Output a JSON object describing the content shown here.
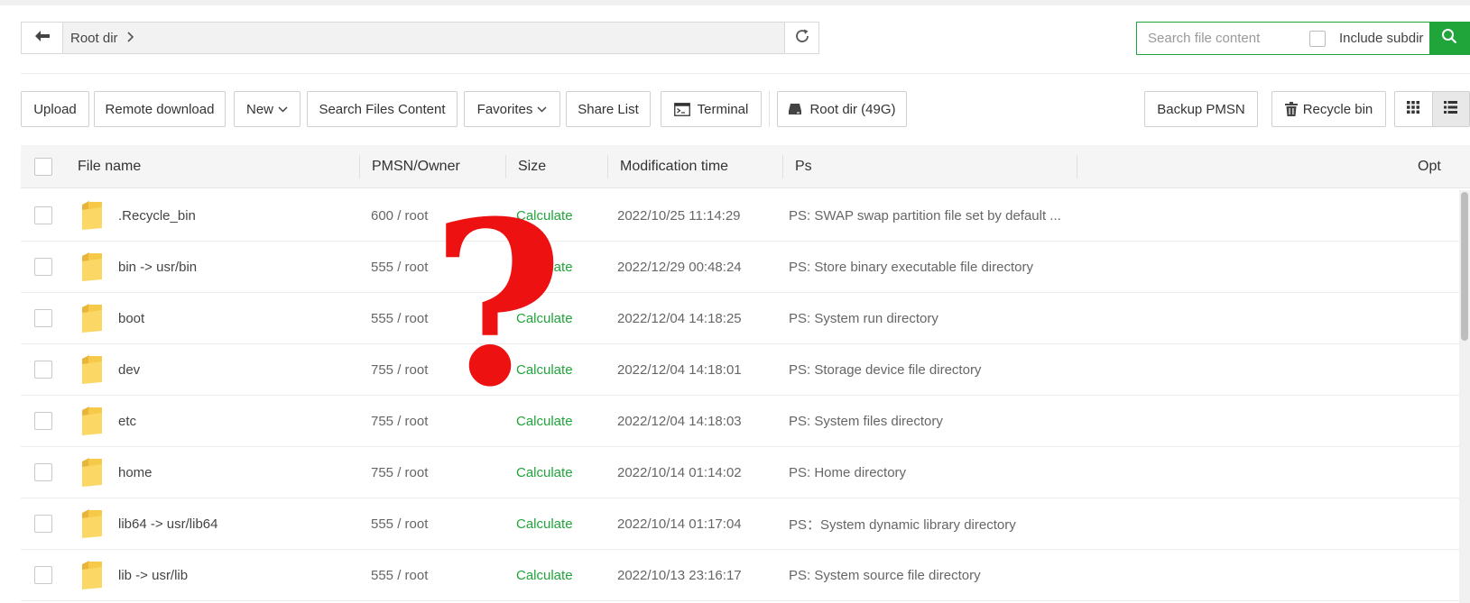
{
  "pathbar": {
    "crumbs": [
      "Root dir"
    ],
    "sep": "›"
  },
  "search": {
    "placeholder": "Search file content",
    "include_label": "Include subdir"
  },
  "toolbar": {
    "upload": "Upload",
    "remote_download": "Remote download",
    "new": "New",
    "search_files_content": "Search Files Content",
    "favorites": "Favorites",
    "share_list": "Share List",
    "terminal": "Terminal",
    "root_dir": "Root dir (49G)",
    "backup": "Backup PMSN",
    "recycle_bin": "Recycle bin"
  },
  "table": {
    "headers": {
      "name": "File name",
      "owner": "PMSN/Owner",
      "size": "Size",
      "mtime": "Modification time",
      "ps": "Ps",
      "opt": "Opt"
    },
    "rows": [
      {
        "name": ".Recycle_bin",
        "owner": "600 / root",
        "size": "Calculate",
        "mtime": "2022/10/25 11:14:29",
        "ps": "PS: SWAP swap partition file set by default ..."
      },
      {
        "name": "bin -> usr/bin",
        "owner": "555 / root",
        "size": "Calculate",
        "mtime": "2022/12/29 00:48:24",
        "ps": "PS: Store binary executable file directory"
      },
      {
        "name": "boot",
        "owner": "555 / root",
        "size": "Calculate",
        "mtime": "2022/12/04 14:18:25",
        "ps": "PS: System run directory"
      },
      {
        "name": "dev",
        "owner": "755 / root",
        "size": "Calculate",
        "mtime": "2022/12/04 14:18:01",
        "ps": "PS: Storage device file directory"
      },
      {
        "name": "etc",
        "owner": "755 / root",
        "size": "Calculate",
        "mtime": "2022/12/04 14:18:03",
        "ps": "PS: System files directory"
      },
      {
        "name": "home",
        "owner": "755 / root",
        "size": "Calculate",
        "mtime": "2022/10/14 01:14:02",
        "ps": "PS: Home directory"
      },
      {
        "name": "lib64 -> usr/lib64",
        "owner": "555 / root",
        "size": "Calculate",
        "mtime": "2022/10/14 01:17:04",
        "ps": " PS：System dynamic library directory"
      },
      {
        "name": "lib -> usr/lib",
        "owner": "555 / root",
        "size": "Calculate",
        "mtime": "2022/10/13 23:16:17",
        "ps": "PS: System source file directory"
      }
    ]
  },
  "overlay": {
    "text": "?",
    "color": "#ee1111"
  },
  "colors": {
    "accent": "#20a53a",
    "folder": "#f7c948"
  },
  "icons": {
    "back": "arrow-left-icon",
    "refresh": "refresh-icon",
    "search": "search-icon",
    "terminal": "terminal-icon",
    "disk": "disk-icon",
    "trash": "trash-icon",
    "grid": "grid-view-icon",
    "list": "list-view-icon",
    "folder": "folder-icon"
  }
}
